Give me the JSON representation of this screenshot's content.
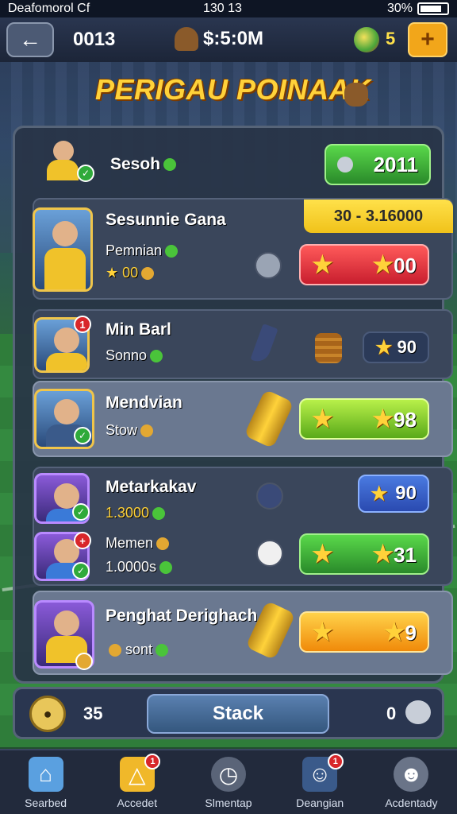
{
  "status_bar": {
    "carrier": "Deafomorol Cf",
    "time": "130 13",
    "battery": "30%"
  },
  "topbar": {
    "coins": "0013",
    "money": "$:5:0M",
    "gems": "5"
  },
  "title": "PERIGAU POINAAK",
  "header_row": {
    "label": "Sesoh",
    "button_value": "2011"
  },
  "rows": [
    {
      "name": "Sesunnie Gana",
      "sub1": "Pemnian",
      "sub2": "00",
      "banner": "30 - 3.16000",
      "button": "00",
      "button_color": "red"
    },
    {
      "name": "Min Barl",
      "sub1": "Sonno",
      "badge": "1",
      "button": "90",
      "button_color": "plain"
    },
    {
      "name": "Mendvian",
      "sub1": "Stow",
      "button": "98",
      "button_color": "green"
    },
    {
      "name": "Metarkakav",
      "sub1": "1.3000",
      "button": "90",
      "button_color": "blue"
    },
    {
      "name": "Memen",
      "sub1": "1.0000s",
      "button": "31",
      "button_color": "dkgreen"
    },
    {
      "name": "Penghat Derighach",
      "sub1": "sont",
      "button": "9",
      "button_color": "orange"
    }
  ],
  "action_bar": {
    "left_count": "35",
    "stack_label": "Stack",
    "right_count": "0"
  },
  "nav": [
    {
      "label": "Searbed",
      "icon": "home-icon"
    },
    {
      "label": "Accedet",
      "icon": "trophy-icon",
      "badge": "1"
    },
    {
      "label": "Slmentap",
      "icon": "clock-icon"
    },
    {
      "label": "Deangian",
      "icon": "player-avatar-icon",
      "badge": "1"
    },
    {
      "label": "Acdentady",
      "icon": "profile-icon"
    }
  ],
  "colors": {
    "accent_gold": "#ffd23a",
    "panel": "#283446",
    "red": "#c81e2e",
    "green": "#5aaa1a",
    "blue": "#2a4ab0",
    "orange": "#f08a0a"
  }
}
